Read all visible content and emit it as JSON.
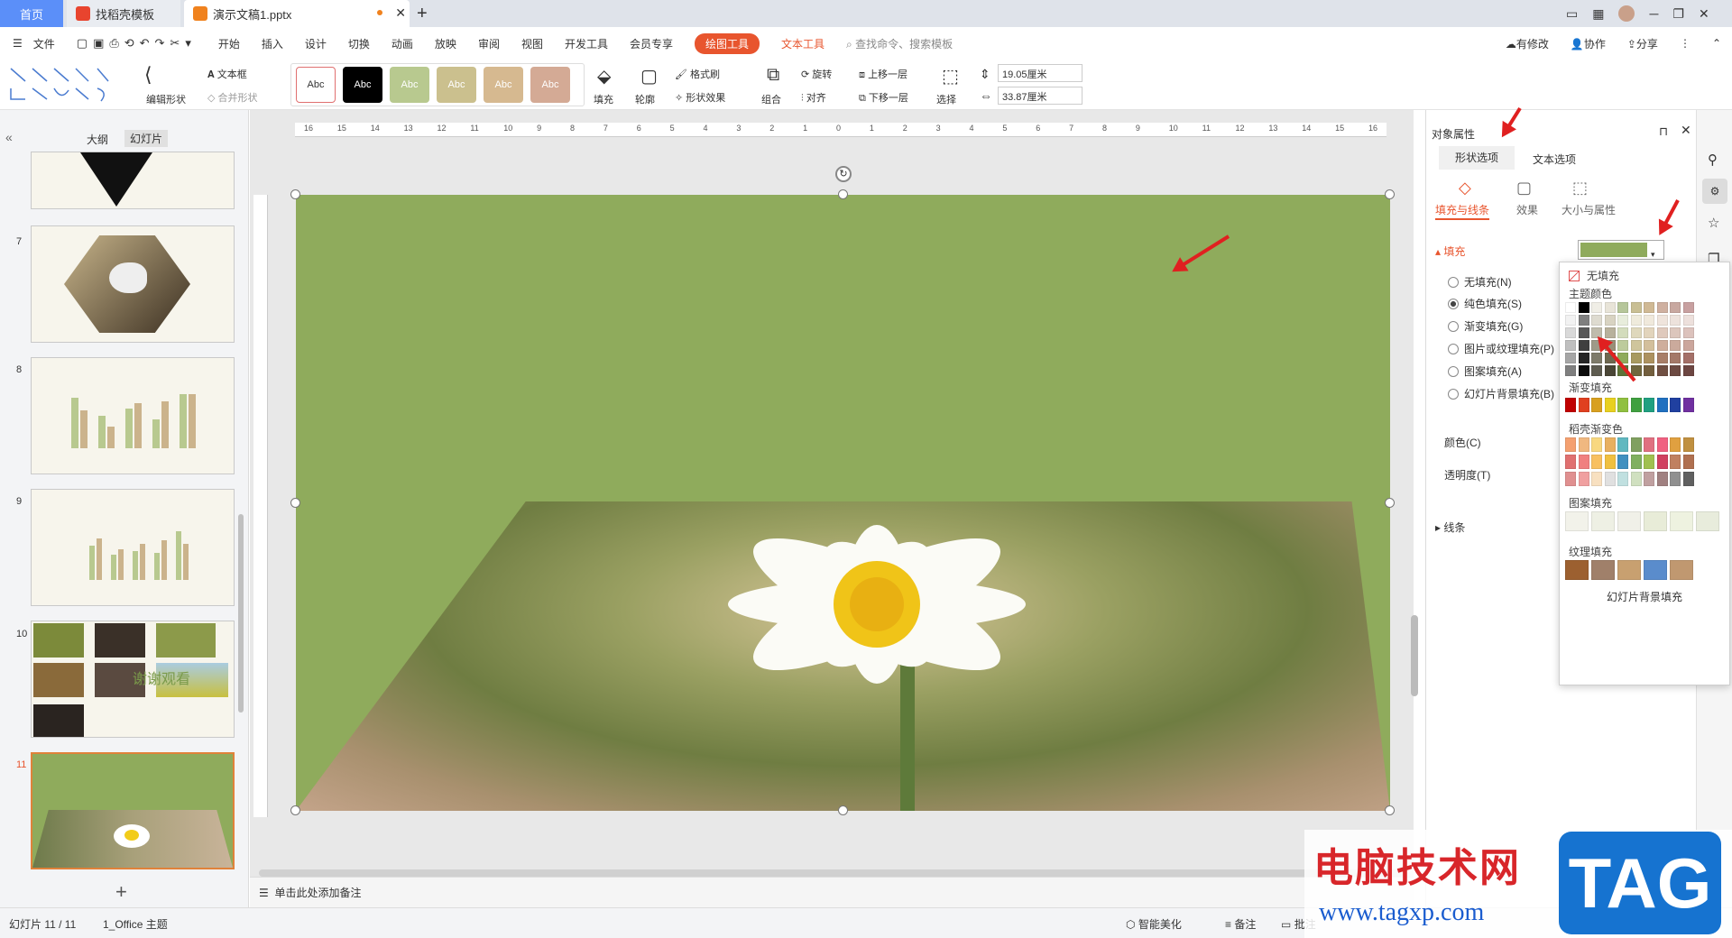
{
  "tabs": {
    "home": "首页",
    "find": "找稻壳模板",
    "doc": "演示文稿1.pptx"
  },
  "menu": {
    "file": "文件",
    "items": [
      "开始",
      "插入",
      "设计",
      "切换",
      "动画",
      "放映",
      "审阅",
      "视图",
      "开发工具",
      "会员专享"
    ],
    "drawing_tools": "绘图工具",
    "text_tools": "文本工具",
    "search": "查找命令、搜索模板",
    "modified": "有修改",
    "collab": "协作",
    "share": "分享"
  },
  "toolbar": {
    "edit_shape": "编辑形状",
    "textbox": "文本框",
    "merge_shape": "合并形状",
    "styles": [
      "Abc",
      "Abc",
      "Abc",
      "Abc",
      "Abc",
      "Abc"
    ],
    "fill": "填充",
    "outline": "轮廓",
    "format_brush": "格式刷",
    "shape_effect": "形状效果",
    "rotate": "旋转",
    "align": "对齐",
    "group": "组合",
    "bring_forward": "上移一层",
    "send_backward": "下移一层",
    "select": "选择",
    "height": "19.05厘米",
    "width": "33.87厘米"
  },
  "left_panel": {
    "tab_outline": "大纲",
    "tab_slides": "幻灯片",
    "slide_numbers": [
      "7",
      "8",
      "9",
      "10",
      "11"
    ],
    "thumb10_text": "谢谢观看"
  },
  "ruler_labels": [
    "16",
    "15",
    "14",
    "13",
    "12",
    "11",
    "10",
    "9",
    "8",
    "7",
    "6",
    "5",
    "4",
    "3",
    "2",
    "1",
    "0",
    "1",
    "2",
    "3",
    "4",
    "5",
    "6",
    "7",
    "8",
    "9",
    "10",
    "11",
    "12",
    "13",
    "14",
    "15",
    "16"
  ],
  "notes": "单击此处添加备注",
  "right_panel": {
    "title": "对象属性",
    "tab_shape": "形状选项",
    "tab_text": "文本选项",
    "sub_fill_line": "填充与线条",
    "sub_effect": "效果",
    "sub_size": "大小与属性",
    "fill_header": "填充",
    "options": [
      "无填充(N)",
      "纯色填充(S)",
      "渐变填充(G)",
      "图片或纹理填充(P)",
      "图案填充(A)",
      "幻灯片背景填充(B)"
    ],
    "color_label": "颜色(C)",
    "transparency_label": "透明度(T)",
    "line_header": "线条",
    "fill_color": "#8fab5c"
  },
  "popup": {
    "no_fill": "无填充",
    "theme_colors": "主题颜色",
    "gradient_fill": "渐变填充",
    "docer_gradient": "稻壳渐变色",
    "pattern_fill": "图案填充",
    "texture_fill": "纹理填充",
    "slide_bg_fill": "幻灯片背景填充"
  },
  "status": {
    "slide_info": "幻灯片 11 / 11",
    "theme": "1_Office 主题",
    "beautify": "智能美化",
    "notes": "备注",
    "comments": "批注"
  },
  "watermark": {
    "text": "电脑技术网",
    "url": "www.tagxp.com",
    "tag": "TAG"
  },
  "colors": {
    "accent_orange": "#e8552e",
    "slide_green": "#8fab5c",
    "arrow_red": "#e02020",
    "blue_tab": "#5b8ff9"
  }
}
